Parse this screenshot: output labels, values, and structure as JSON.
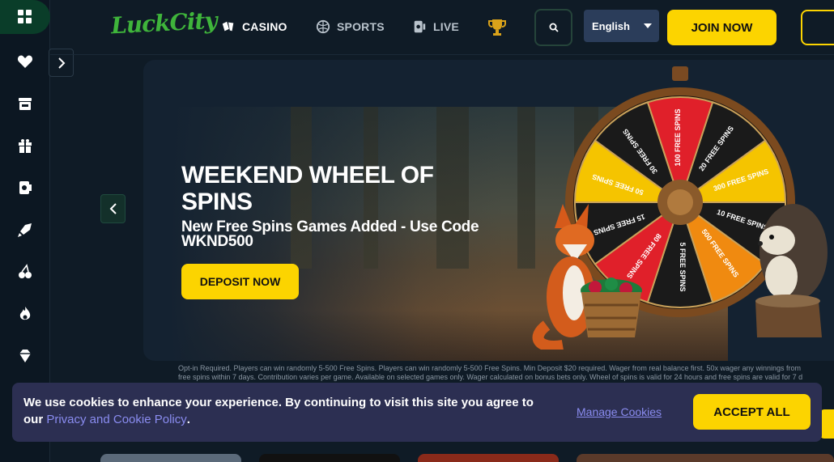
{
  "brand": {
    "logo_text": "LuckCity",
    "accent": "#fcd400",
    "green": "#3fb53b"
  },
  "sidebar": {
    "items": [
      {
        "icon": "grid-icon"
      },
      {
        "icon": "heart-icon"
      },
      {
        "icon": "store-icon"
      },
      {
        "icon": "gift-icon"
      },
      {
        "icon": "card-icon"
      },
      {
        "icon": "rocket-icon"
      },
      {
        "icon": "cherries-icon"
      },
      {
        "icon": "flame-icon"
      },
      {
        "icon": "diamond-icon"
      }
    ]
  },
  "header": {
    "nav": [
      {
        "label": "CASINO",
        "icon": "cards-icon"
      },
      {
        "label": "SPORTS",
        "icon": "ball-icon"
      },
      {
        "label": "LIVE",
        "icon": "live-card-icon"
      }
    ],
    "language": "English",
    "join_label": "JOIN NOW"
  },
  "banner": {
    "title": "WEEKEND WHEEL OF SPINS",
    "subtitle": "New Free Spins Games Added - Use Code WKND500",
    "cta": "DEPOSIT NOW",
    "wheel_segments": [
      "100 FREE SPINS",
      "20 FREE SPINS",
      "300 FREE SPINS",
      "10 FREE SPINS",
      "500 FREE SPINS",
      "5 FREE SPINS",
      "80 FREE SPINS",
      "15 FREE SPINS",
      "50 FREE SPINS",
      "30 FREE SPINS"
    ],
    "terms_line1": "Opt-in Required. Players can win randomly 5-500 Free Spins. Players can win randomly 5-500 Free Spins. Min Deposit $20 required. Wager from real balance first. 50x wager any winnings from",
    "terms_line2": "free spins within 7 days. Contribution varies per game. Available on selected games only. Wager calculated on bonus bets only. Wheel of spins is valid for 24 hours and free spins are valid for 7 d"
  },
  "cookie": {
    "text": "We use cookies to enhance your experience. By continuing to visit this site you agree to our",
    "link": "Privacy and Cookie Policy",
    "end": ".",
    "manage": "Manage Cookies",
    "accept": "ACCEPT ALL"
  }
}
